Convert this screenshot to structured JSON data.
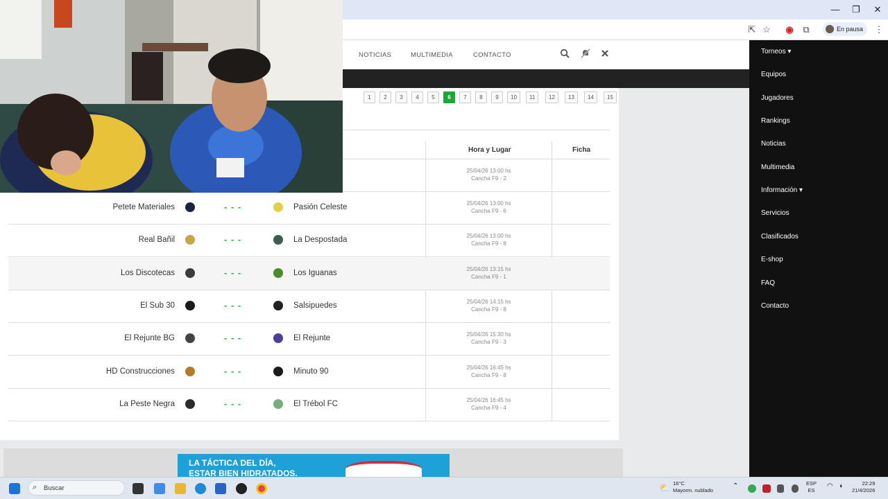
{
  "browser": {
    "profile_label": "En pausa",
    "window_controls": {
      "minimize": "—",
      "maximize": "❐",
      "close": "✕"
    }
  },
  "site_nav": {
    "links": [
      "NOTICIAS",
      "MULTIMEDIA",
      "CONTACTO"
    ]
  },
  "pagination": {
    "pages": [
      "1",
      "2",
      "3",
      "4",
      "5",
      "6",
      "7",
      "8",
      "9",
      "10",
      "11",
      "12",
      "13",
      "14",
      "15"
    ],
    "active": "6"
  },
  "table": {
    "headers": {
      "time_place": "Hora y Lugar",
      "sheet": "Ficha"
    },
    "first_row": {
      "datetime": "25/04/26 13:00 hs",
      "field": "Cancha F9 - 2"
    },
    "rows": [
      {
        "home": "Petete Materiales",
        "score": "- - -",
        "away": "Pasión Celeste",
        "datetime": "25/04/26 13:00 hs",
        "field": "Cancha F9 - 6"
      },
      {
        "home": "Real Bañil",
        "score": "- - -",
        "away": "La Despostada",
        "datetime": "25/04/26 13:00 hs",
        "field": "Cancha F9 - 8"
      },
      {
        "home": "Los Discotecas",
        "score": "- - -",
        "away": "Los Iguanas",
        "datetime": "25/04/26 13:15 hs",
        "field": "Cancha F9 - 1"
      },
      {
        "home": "El Sub 30",
        "score": "- - -",
        "away": "Salsipuedes",
        "datetime": "25/04/26 14:15 hs",
        "field": "Cancha F9 - 8"
      },
      {
        "home": "El Rejunte BG",
        "score": "- - -",
        "away": "El Rejunte",
        "datetime": "25/04/26 15:30 hs",
        "field": "Cancha F9 - 3"
      },
      {
        "home": "HD Construcciones",
        "score": "- - -",
        "away": "Minuto 90",
        "datetime": "25/04/26 16:45 hs",
        "field": "Cancha F9 - 8"
      },
      {
        "home": "La Peste Negra",
        "score": "- - -",
        "away": "El Trébol FC",
        "datetime": "25/04/26 16:45 hs",
        "field": "Cancha F9 - 4"
      }
    ]
  },
  "ad": {
    "line1": "LA TÁCTICA DEL DÍA,",
    "line2": "ESTAR BIEN HIDRATADOS."
  },
  "sidebar": {
    "items": [
      "Torneos ▾",
      "Equipos",
      "Jugadores",
      "Rankings",
      "Noticias",
      "Multimedia",
      "Información ▾",
      "Servicios",
      "Clasificados",
      "E-shop",
      "FAQ",
      "Contacto"
    ]
  },
  "taskbar": {
    "search_placeholder": "Buscar",
    "weather_temp": "16°C",
    "weather_desc": "Mayorm. nublado",
    "lang_top": "ESP",
    "lang_bottom": "ES",
    "time": "22:29",
    "date": "21/4/2026"
  },
  "colors": {
    "accent_green": "#1aa935",
    "sidebar_bg": "#111111",
    "score_green": "#2eae3f"
  }
}
